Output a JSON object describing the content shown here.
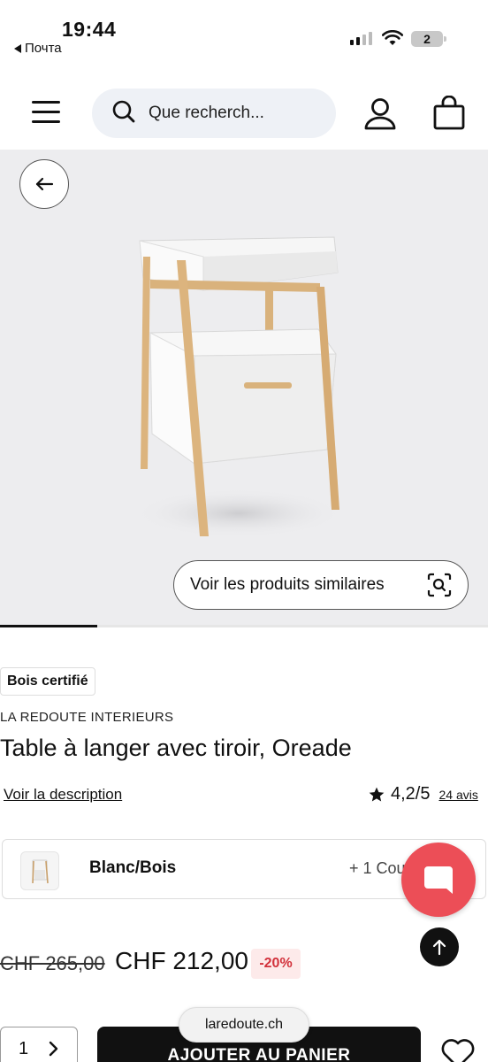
{
  "status_bar": {
    "time": "19:44",
    "back_app": "Почта",
    "battery": "2"
  },
  "header": {
    "search_placeholder": "Que recherch..."
  },
  "hero": {
    "similar_label": "Voir les produits similaires",
    "gallery_progress_fraction": 0.2
  },
  "product": {
    "badge": "Bois certifié",
    "brand": "LA REDOUTE INTERIEURS",
    "title": "Table à langer avec tiroir, Oreade",
    "description_link": "Voir la description",
    "rating": "4,2/5",
    "review_count": "24 avis"
  },
  "variant": {
    "color": "Blanc/Bois",
    "more": "+ 1 Cou"
  },
  "price": {
    "old": "CHF 265,00",
    "new": "CHF 212,00",
    "discount": "-20%"
  },
  "purchase": {
    "quantity": "1",
    "cart_label": "AJOUTER AU PANIER"
  },
  "browser": {
    "url": "laredoute.ch"
  },
  "colors": {
    "accent_red": "#ec4e57",
    "discount_red": "#d2313b",
    "dark": "#111111",
    "search_bg": "#eef1f6",
    "hero_bg": "#ededef"
  }
}
